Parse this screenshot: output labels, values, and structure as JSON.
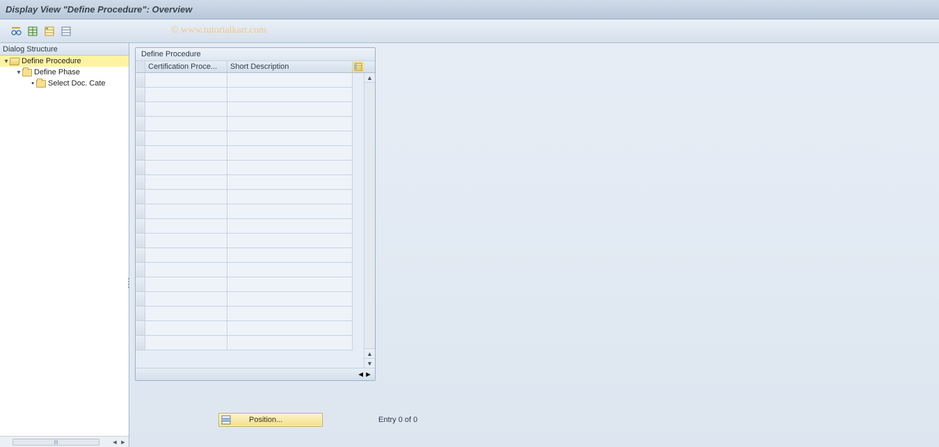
{
  "title": "Display View \"Define Procedure\": Overview",
  "watermark": "© www.tutorialkart.com",
  "toolbar": {
    "edit_tooltip": "Change",
    "detail_tooltip": "Details",
    "expand_tooltip": "Expand All",
    "collapse_tooltip": "Collapse All"
  },
  "tree": {
    "header": "Dialog Structure",
    "items": [
      {
        "label": "Define Procedure",
        "level": 1,
        "open": true,
        "selected": true,
        "expander": "▾"
      },
      {
        "label": "Define Phase",
        "level": 2,
        "open": false,
        "selected": false,
        "expander": "▾"
      },
      {
        "label": "Select Doc. Cate",
        "level": 3,
        "open": false,
        "selected": false,
        "expander": "•"
      }
    ]
  },
  "table": {
    "title": "Define Procedure",
    "columns": {
      "cert": "Certification Proce...",
      "desc": "Short Description"
    },
    "row_count": 19
  },
  "position_button": "Position...",
  "entry_status": "Entry 0 of 0"
}
